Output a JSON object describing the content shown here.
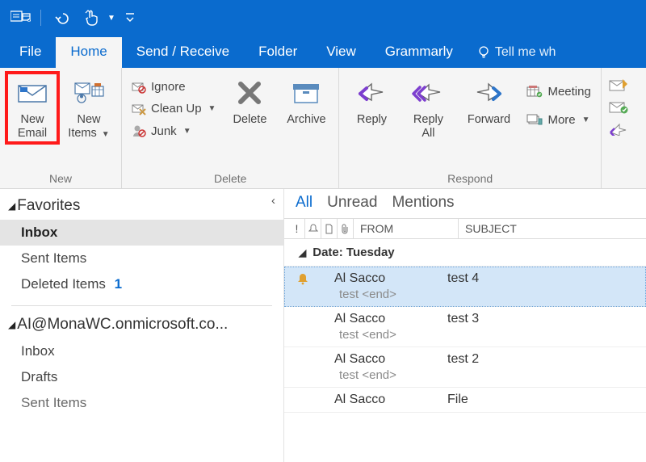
{
  "titlebar": {
    "icons": [
      "outlook-calendar-icon",
      "undo-icon",
      "touch-mode-icon",
      "customize-icon"
    ]
  },
  "tabs": {
    "file": "File",
    "home": "Home",
    "send_receive": "Send / Receive",
    "folder": "Folder",
    "view": "View",
    "grammarly": "Grammarly",
    "tell_me": "Tell me wh"
  },
  "ribbon": {
    "new": {
      "caption": "New",
      "new_email": "New\nEmail",
      "new_items": "New\nItems"
    },
    "delete": {
      "caption": "Delete",
      "ignore": "Ignore",
      "clean_up": "Clean Up",
      "junk": "Junk",
      "delete": "Delete",
      "archive": "Archive"
    },
    "respond": {
      "caption": "Respond",
      "reply": "Reply",
      "reply_all": "Reply\nAll",
      "forward": "Forward",
      "meeting": "Meeting",
      "more": "More"
    }
  },
  "nav": {
    "favorites": {
      "header": "Favorites",
      "items": [
        {
          "label": "Inbox",
          "selected": true
        },
        {
          "label": "Sent Items"
        },
        {
          "label": "Deleted Items",
          "count": "1"
        }
      ]
    },
    "account": {
      "header": "AI@MonaWC.onmicrosoft.co...",
      "items": [
        {
          "label": "Inbox"
        },
        {
          "label": "Drafts"
        },
        {
          "label": "Sent Items"
        }
      ]
    }
  },
  "filters": {
    "all": "All",
    "unread": "Unread",
    "mentions": "Mentions"
  },
  "columns": {
    "from": "FROM",
    "subject": "SUBJECT"
  },
  "groups": [
    {
      "label": "Date: Tuesday",
      "messages": [
        {
          "from": "Al Sacco",
          "subject": "test 4",
          "preview": "test  <end>",
          "bell": true,
          "selected": true
        },
        {
          "from": "Al Sacco",
          "subject": "test 3",
          "preview": "test  <end>"
        },
        {
          "from": "Al Sacco",
          "subject": "test 2",
          "preview": "test  <end>"
        },
        {
          "from": "Al Sacco",
          "subject": "File",
          "preview": ""
        }
      ]
    }
  ]
}
